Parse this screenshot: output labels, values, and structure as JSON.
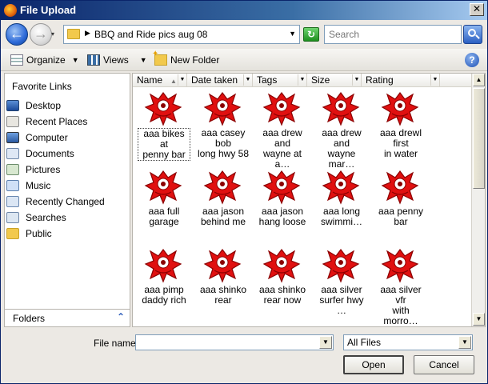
{
  "window": {
    "title": "File Upload",
    "close_glyph": "✕"
  },
  "nav": {
    "back_glyph": "←",
    "forward_glyph": "→",
    "history_glyph": "▾",
    "breadcrumb_arrow": "▶",
    "path": "BBQ and Ride pics aug 08",
    "dropdown_glyph": "▼",
    "refresh_glyph": "↻",
    "search_placeholder": "Search"
  },
  "toolbar": {
    "organize_label": "Organize",
    "views_label": "Views",
    "new_folder_label": "New Folder",
    "dropdown_glyph": "▼",
    "help_glyph": "?"
  },
  "sidebar": {
    "title": "Favorite Links",
    "items": [
      {
        "label": "Desktop",
        "icon": "desktop-icon"
      },
      {
        "label": "Recent Places",
        "icon": "recent-places-icon"
      },
      {
        "label": "Computer",
        "icon": "computer-icon"
      },
      {
        "label": "Documents",
        "icon": "documents-icon"
      },
      {
        "label": "Pictures",
        "icon": "pictures-icon"
      },
      {
        "label": "Music",
        "icon": "music-icon"
      },
      {
        "label": "Recently Changed",
        "icon": "recently-changed-icon"
      },
      {
        "label": "Searches",
        "icon": "searches-icon"
      },
      {
        "label": "Public",
        "icon": "folder-icon"
      }
    ],
    "folders_label": "Folders",
    "folders_chevron": "⌃"
  },
  "columns": {
    "name": "Name",
    "date_taken": "Date taken",
    "tags": "Tags",
    "size": "Size",
    "rating": "Rating",
    "sort_glyph": "▲",
    "dropdown_glyph": "▼"
  },
  "files": [
    {
      "line1": "aaa bikes at",
      "line2": "penny bar",
      "selected": true
    },
    {
      "line1": "aaa casey bob",
      "line2": "long hwy 58"
    },
    {
      "line1": "aaa drew and",
      "line2": "wayne at a…"
    },
    {
      "line1": "aaa drew and",
      "line2": "wayne mar…"
    },
    {
      "line1": "aaa drewl first",
      "line2": "in water"
    },
    {
      "line1": "aaa full",
      "line2": "garage"
    },
    {
      "line1": "aaa jason",
      "line2": "behind me"
    },
    {
      "line1": "aaa jason",
      "line2": "hang loose"
    },
    {
      "line1": "aaa long",
      "line2": "swimmi…"
    },
    {
      "line1": "aaa penny bar",
      "line2": ""
    },
    {
      "line1": "aaa pimp",
      "line2": "daddy rich"
    },
    {
      "line1": "aaa shinko",
      "line2": "rear"
    },
    {
      "line1": "aaa shinko",
      "line2": "rear now"
    },
    {
      "line1": "aaa silver",
      "line2": "surfer hwy …"
    },
    {
      "line1": "aaa silver vfr",
      "line2": "with morro…"
    }
  ],
  "scrollbar": {
    "up_glyph": "▲",
    "down_glyph": "▼"
  },
  "bottom": {
    "file_name_label": "File name:",
    "file_name_value": "",
    "filter_value": "All Files",
    "dropdown_glyph": "▼",
    "open_label": "Open",
    "cancel_label": "Cancel"
  },
  "colors": {
    "thumb_red": "#e01010",
    "thumb_dark": "#8a0000",
    "title_bar": "#0a246a"
  }
}
